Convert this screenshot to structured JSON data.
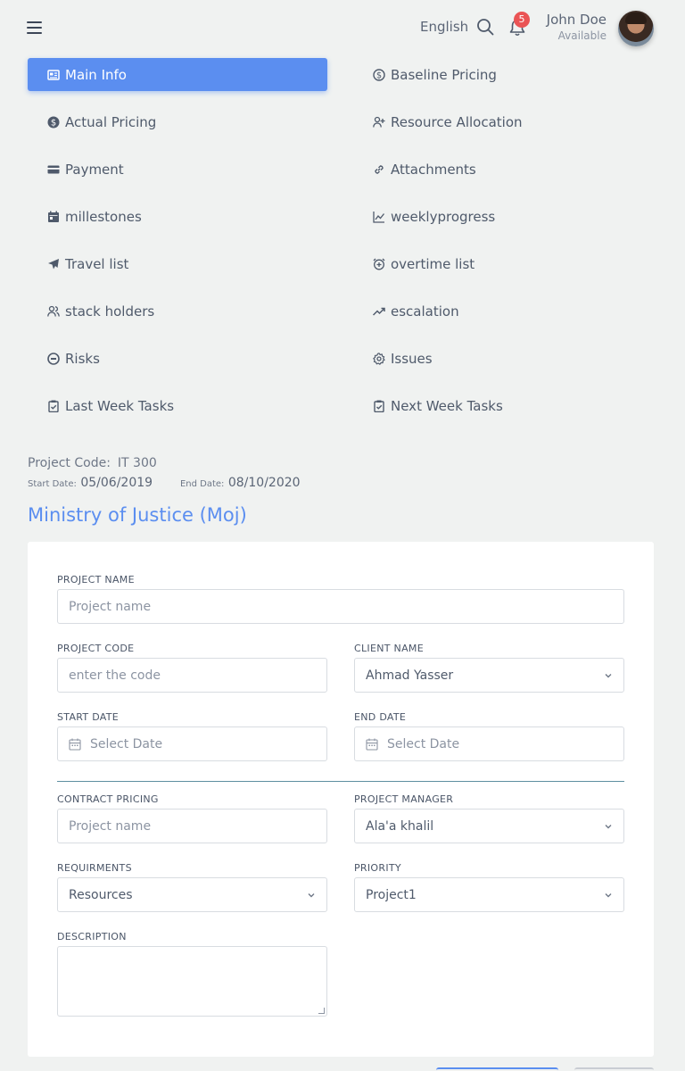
{
  "header": {
    "language": "English",
    "notification_count": "5",
    "user_name": "John Doe",
    "user_status": "Available"
  },
  "nav": {
    "left": [
      {
        "label": "Main Info",
        "icon": "newspaper-icon"
      },
      {
        "label": "Actual Pricing",
        "icon": "dollar-circle-icon"
      },
      {
        "label": "Payment",
        "icon": "credit-card-icon"
      },
      {
        "label": "millestones",
        "icon": "calendar-icon"
      },
      {
        "label": "Travel list",
        "icon": "plane-icon"
      },
      {
        "label": "stack holders",
        "icon": "users-icon"
      },
      {
        "label": "Risks",
        "icon": "minus-circle-icon"
      },
      {
        "label": "Last Week Tasks",
        "icon": "clipboard-check-icon"
      }
    ],
    "right": [
      {
        "label": "Baseline Pricing",
        "icon": "dollar-circle-outline-icon"
      },
      {
        "label": "Resource Allocation",
        "icon": "user-plus-icon"
      },
      {
        "label": "Attachments",
        "icon": "link-icon"
      },
      {
        "label": "weeklyprogress",
        "icon": "line-chart-icon"
      },
      {
        "label": "overtime list",
        "icon": "alarm-plus-icon"
      },
      {
        "label": "escalation",
        "icon": "trending-up-icon"
      },
      {
        "label": "Issues",
        "icon": "gear-icon"
      },
      {
        "label": "Next Week Tasks",
        "icon": "clipboard-check-icon"
      }
    ]
  },
  "project": {
    "code_label": "Project Code:",
    "code_value": "IT 300",
    "start_label": "Start Date:",
    "start_value": "05/06/2019",
    "end_label": "End Date:",
    "end_value": "08/10/2020",
    "client_title": "Ministry of Justice (Moj)"
  },
  "form": {
    "project_name_label": "PROJECT NAME",
    "project_name_placeholder": "Project name",
    "project_code_label": "PROJECT CODE",
    "project_code_placeholder": "enter the code",
    "client_name_label": "CLIENT NAME",
    "client_name_value": "Ahmad Yasser",
    "start_date_label": "START DATE",
    "start_date_placeholder": "Select Date",
    "end_date_label": "END DATE",
    "end_date_placeholder": "Select Date",
    "contract_pricing_label": "CONTRACT PRICING",
    "contract_pricing_placeholder": "Project name",
    "project_manager_label": "PROJECT MANAGER",
    "project_manager_value": "Ala'a khalil",
    "requirements_label": "REQUIRMENTS",
    "requirements_value": "Resources",
    "priority_label": "PRIORITY",
    "priority_value": "Project1",
    "description_label": "DESCRIPTION"
  },
  "colors": {
    "accent": "#5b8ef0",
    "badge": "#ea5455",
    "background": "#f0f2f1"
  }
}
